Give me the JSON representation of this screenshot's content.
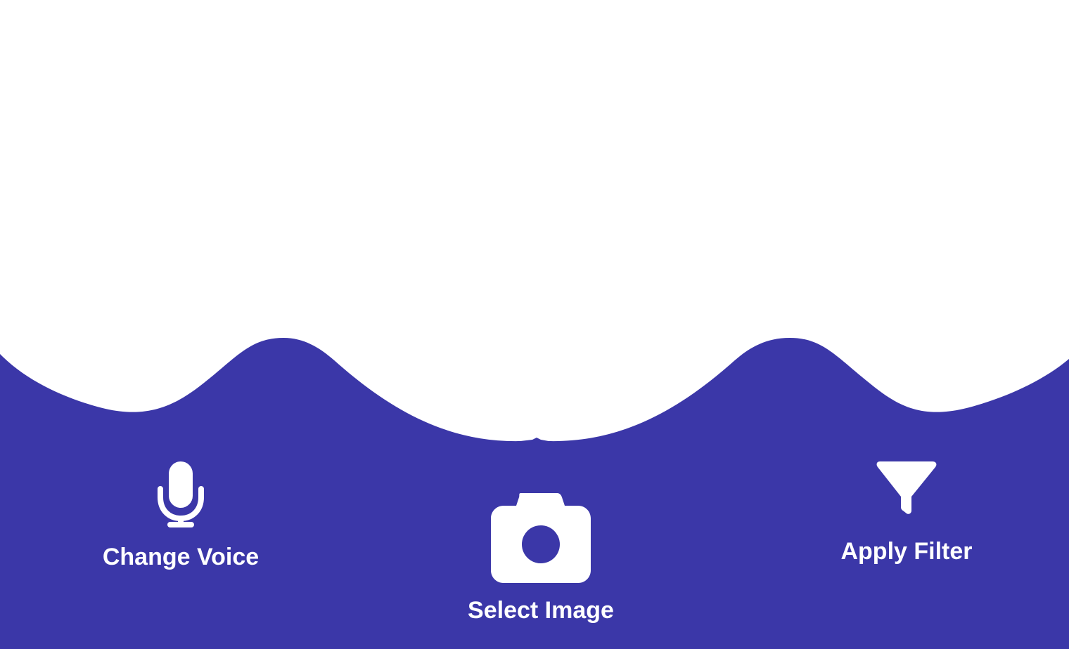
{
  "colors": {
    "background": "#ffffff",
    "accent": "#3b37a8",
    "icon": "#ffffff",
    "text": "#ffffff"
  },
  "actions": [
    {
      "id": "change_voice",
      "icon": "microphone-icon",
      "label": "Change Voice"
    },
    {
      "id": "select_image",
      "icon": "camera-icon",
      "label": "Select Image"
    },
    {
      "id": "apply_filter",
      "icon": "filter-icon",
      "label": "Apply Filter"
    }
  ]
}
